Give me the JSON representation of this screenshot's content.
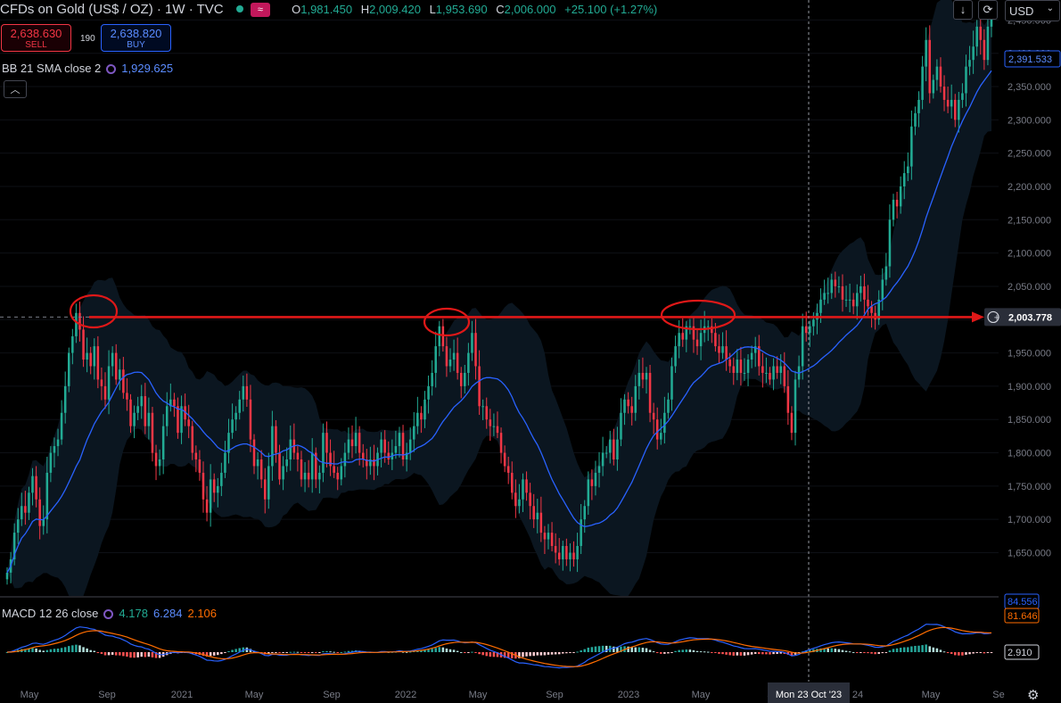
{
  "header": {
    "symbol": "CFDs on Gold (US$ / OZ) · 1W · TVC",
    "pill_icon": "approx-icon",
    "o_label": "O",
    "o": "1,981.450",
    "h_label": "H",
    "h": "2,009.420",
    "l_label": "L",
    "l": "1,953.690",
    "c_label": "C",
    "c": "2,006.000",
    "change": "+25.100 (+1.27%)"
  },
  "trade": {
    "sell_price": "2,638.630",
    "sell_label": "SELL",
    "spread": "190",
    "buy_price": "2,638.820",
    "buy_label": "BUY"
  },
  "bb": {
    "label": "BB 21 SMA close 2",
    "value": "1,929.625"
  },
  "macd_legend": {
    "label": "MACD 12 26 close",
    "v1": "4.178",
    "v2": "6.284",
    "v3": "2.106"
  },
  "toolbar": {
    "currency": "USD",
    "collapse_icon": "chevron-up-icon",
    "download_icon": "arrow-down-icon",
    "refresh_icon": "refresh-icon",
    "settings_icon": "gear-icon"
  },
  "colors": {
    "up": "#22ab94",
    "down": "#f23645",
    "basis": "#2962ff",
    "signal": "#ff6d00",
    "level": "#e01818",
    "band_fill": "#0b1620"
  },
  "chart_data": {
    "type": "candlestick",
    "title": "CFDs on Gold (US$ / OZ) · 1W · TVC",
    "ylim": [
      1585,
      2480
    ],
    "y_ticks": [
      "2,450.000",
      "2,400.000",
      "2,350.000",
      "2,300.000",
      "2,250.000",
      "2,200.000",
      "2,150.000",
      "2,100.000",
      "2,050.000",
      "2,000.000",
      "1,950.000",
      "1,900.000",
      "1,850.000",
      "1,800.000",
      "1,750.000",
      "1,700.000",
      "1,650.000"
    ],
    "x_ticks": [
      "May",
      "Sep",
      "2021",
      "May",
      "Sep",
      "2022",
      "May",
      "Sep",
      "2023",
      "May",
      "Sep",
      "24",
      "May",
      "Se"
    ],
    "crosshair_date": "Mon 23 Oct '23",
    "price_labels": {
      "level": "2,003.778",
      "basis": "2,391.533"
    },
    "level_line": 2003.778,
    "weekly_close": [
      1620,
      1640,
      1680,
      1700,
      1720,
      1710,
      1740,
      1765,
      1730,
      1690,
      1700,
      1770,
      1800,
      1810,
      1820,
      1860,
      1900,
      1950,
      1975,
      2010,
      1985,
      1940,
      1950,
      1930,
      1960,
      1910,
      1900,
      1880,
      1930,
      1950,
      1910,
      1925,
      1890,
      1880,
      1840,
      1860,
      1870,
      1885,
      1840,
      1860,
      1800,
      1780,
      1790,
      1840,
      1870,
      1880,
      1870,
      1830,
      1870,
      1850,
      1840,
      1800,
      1790,
      1770,
      1730,
      1710,
      1760,
      1740,
      1750,
      1770,
      1800,
      1830,
      1850,
      1860,
      1880,
      1900,
      1880,
      1820,
      1780,
      1790,
      1760,
      1730,
      1780,
      1840,
      1800,
      1760,
      1780,
      1790,
      1820,
      1800,
      1790,
      1760,
      1770,
      1760,
      1800,
      1760,
      1770,
      1830,
      1800,
      1780,
      1770,
      1760,
      1780,
      1800,
      1820,
      1810,
      1830,
      1800,
      1790,
      1780,
      1790,
      1780,
      1800,
      1820,
      1800,
      1790,
      1800,
      1810,
      1830,
      1790,
      1800,
      1820,
      1840,
      1860,
      1850,
      1880,
      1900,
      1920,
      1960,
      1990,
      1960,
      1930,
      1940,
      1950,
      1920,
      1900,
      1920,
      1950,
      1980,
      1930,
      1870,
      1870,
      1850,
      1840,
      1840,
      1830,
      1800,
      1780,
      1770,
      1740,
      1720,
      1730,
      1760,
      1740,
      1720,
      1700,
      1710,
      1680,
      1670,
      1680,
      1660,
      1650,
      1640,
      1660,
      1640,
      1650,
      1640,
      1660,
      1700,
      1720,
      1760,
      1750,
      1770,
      1780,
      1800,
      1800,
      1820,
      1790,
      1820,
      1860,
      1880,
      1870,
      1860,
      1900,
      1920,
      1910,
      1920,
      1860,
      1850,
      1820,
      1830,
      1860,
      1880,
      1930,
      1960,
      1980,
      1970,
      1990,
      1990,
      1970,
      1960,
      1980,
      1990,
      1990,
      1980,
      1960,
      1950,
      1960,
      1940,
      1930,
      1920,
      1940,
      1920,
      1920,
      1940,
      1950,
      1960,
      1930,
      1920,
      1920,
      1910,
      1930,
      1920,
      1930,
      1900,
      1860,
      1830,
      1910,
      1930,
      1990,
      1980,
      1990,
      2000,
      2010,
      2030,
      2040,
      2040,
      2060,
      2050,
      2050,
      2030,
      2030,
      2030,
      2020,
      2040,
      2050,
      2030,
      2020,
      2010,
      2000,
      2030,
      2060,
      2080,
      2150,
      2180,
      2170,
      2200,
      2220,
      2230,
      2290,
      2310,
      2330,
      2380,
      2420,
      2340,
      2360,
      2380,
      2350,
      2330,
      2320,
      2330,
      2300,
      2330,
      2340,
      2380,
      2390,
      2410,
      2440,
      2420,
      2390,
      2440,
      2470
    ]
  }
}
